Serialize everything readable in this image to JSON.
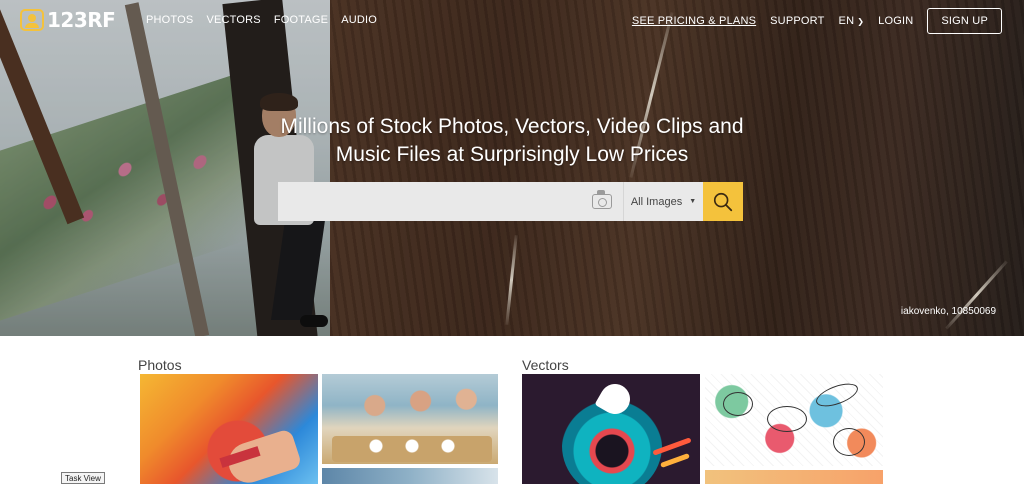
{
  "nav": {
    "logo_text": "123RF",
    "links": [
      "PHOTOS",
      "VECTORS",
      "FOOTAGE",
      "AUDIO"
    ],
    "pricing": "SEE PRICING & PLANS",
    "support": "SUPPORT",
    "language": "EN",
    "login": "LOGIN",
    "signup": "SIGN UP"
  },
  "hero": {
    "headline_line1": "Millions of Stock Photos, Vectors, Video Clips and",
    "headline_line2": "Music Files at Surprisingly Low Prices",
    "search_value": "",
    "search_type": "All Images",
    "photo_credit": "iakovenko, 10850069"
  },
  "sections": {
    "photos_title": "Photos",
    "vectors_title": "Vectors"
  },
  "tooltip": {
    "task_view": "Task View"
  },
  "colors": {
    "accent": "#f4c23c"
  },
  "icons": {
    "search": "magnifier-icon",
    "camera": "camera-icon",
    "dropdown": "caret-down-icon"
  }
}
